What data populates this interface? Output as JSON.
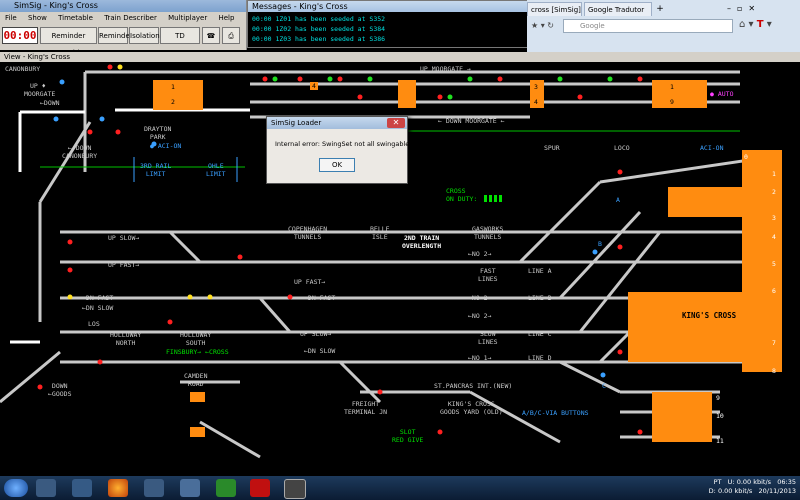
{
  "simsig": {
    "title": "SimSig - King's Cross",
    "menu": [
      "File",
      "Show",
      "Timetable",
      "Train Describer",
      "Multiplayer",
      "Help"
    ],
    "clock": "00:00",
    "buttons": [
      "Reminder Override",
      "Reminder",
      "Isolation",
      "TD Interpose"
    ]
  },
  "messages": {
    "title": "Messages - King's Cross",
    "lines": [
      "00:00 1Z01 has been seeded at S352",
      "00:00 1Z02 has been seeded at S384",
      "00:00 1Z03 has been seeded at S386"
    ]
  },
  "browser": {
    "tab1": "cross [SimSig]",
    "tab2": "Google Tradutor",
    "search_placeholder": "Google"
  },
  "view": {
    "title": "View - King's Cross",
    "labels": {
      "up_moorgate": "UP ♦",
      "moorgate": "MOORGATE",
      "down_arrow": "←DOWN",
      "canonbury_top": "CANONBURY",
      "drayton_park": "DRAYTON\nPARK",
      "aci_on_1": "● ACI-ON",
      "down_canonbury": "← DOWN\nCANONBURY",
      "third_rail": "3RD RAIL\nLIMIT",
      "ohle": "OHLE\nLIMIT",
      "up_moorgate_top": "UP MOORGATE →",
      "down_moorgate": "← DOWN MOORGATE ←",
      "auto": "● AUTO",
      "spur": "SPUR",
      "loco": "LOCO",
      "aci_on_2": "ACI-ON",
      "cross_on_duty": "CROSS\nON DUTY:",
      "copenhagen": "COPENHAGEN\nTUNNELS",
      "belle_isle": "BELLE\nISLE",
      "second_train": "2ND TRAIN\nOVERLENGTH",
      "gasworks": "GASWORKS\nTUNNELS",
      "up_slow_1": "UP SLOW→",
      "up_fast_1": "UP FAST→",
      "dn_fast": "←DN FAST",
      "dn_slow": "←DN SLOW",
      "up_fast_2": "UP FAST→",
      "dn_fast_2": "←DN FAST",
      "up_slow_2": "UP SLOW→",
      "dn_slow_2": "←DN SLOW",
      "no2_1": "←NO 2→",
      "fast_lines": "FAST\nLINES",
      "no2_2": "←NO 2→",
      "no2_3": "←NO 2→",
      "slow_lines": "SLOW\nLINES",
      "no1": "←NO 1→",
      "line_a": "LINE A",
      "line_b": "LINE B",
      "line_c": "LINE C",
      "line_d": "LINE D",
      "kings_cross": "KING'S CROSS",
      "los": "LOS",
      "holloway_north": "HOLLOWAY\nNORTH",
      "holloway_south": "HOLLOWAY\nSOUTH",
      "finsbury": "FINSBURY→ ←CROSS",
      "down_goods": "DOWN\n←GOODS",
      "camden_road": "CAMDEN\nROAD",
      "freight": "FREIGHT\nTERMINAL JN",
      "st_pancras": "ST.PANCRAS INT.(NEW)",
      "goods_yard": "KING'S CROSS\nGOODS YARD (OLD)",
      "via_buttons": "A/B/C-VIA BUTTONS",
      "slot": "SLOT\nRED GIVE",
      "plat_a": "A",
      "plat_b": "B",
      "plat_c": "C"
    },
    "platforms": [
      "0",
      "1",
      "2",
      "3",
      "4",
      "5",
      "6",
      "7",
      "8",
      "9",
      "10",
      "11"
    ],
    "box_labels": {
      "b1": "1",
      "b2": "2",
      "b4": "4",
      "b3": "3",
      "b3b": "4",
      "b1r": "1",
      "b9": "9"
    }
  },
  "dialog": {
    "title": "SimSig Loader",
    "message": "Internal error: SwingSet not all swingable",
    "ok": "OK"
  },
  "tray": {
    "lang": "PT",
    "up_rate": "0.00 kbit/s",
    "down_rate": "0.00 kbit/s",
    "time": "06:35",
    "date": "20/11/2013",
    "up_label": "U:",
    "down_label": "D:"
  },
  "colors": {
    "track": "#c8c8c8",
    "platform": "#ff8c10",
    "label_blue": "#3aa0ff",
    "signal_red": "#ff3030",
    "ohle_green": "#00e000"
  }
}
